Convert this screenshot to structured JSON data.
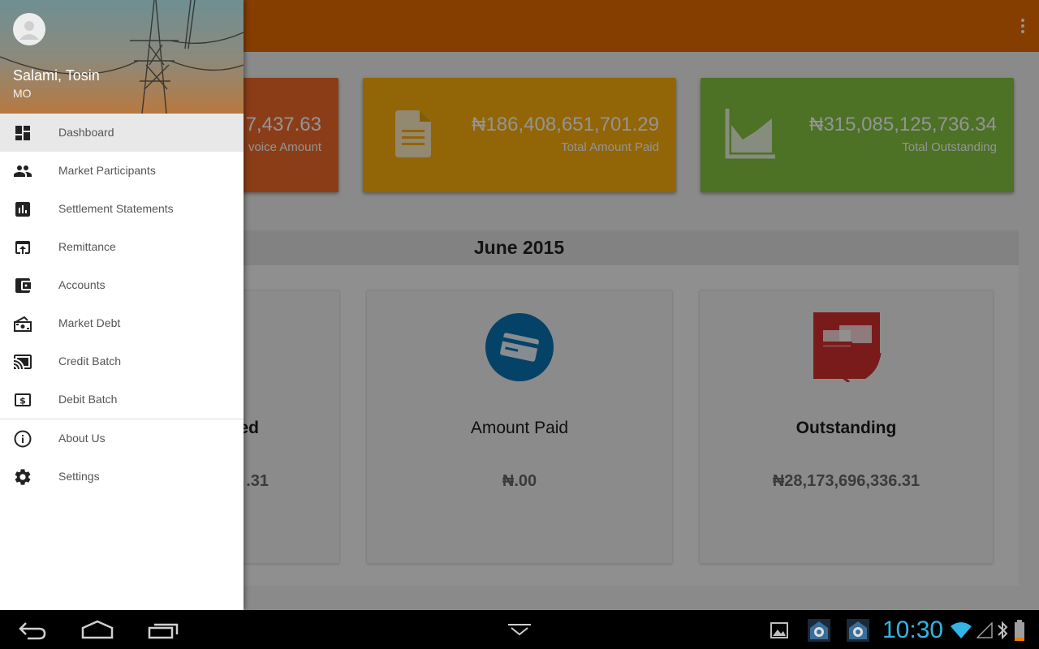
{
  "app": {
    "toolbar_color": "#e56a00",
    "overflow_icon": "more-vert-icon"
  },
  "stats": [
    {
      "amount": "7,437.63",
      "caption": "voice Amount",
      "color": "#f06a2a",
      "icon": "invoice-icon"
    },
    {
      "amount": "₦186,408,651,701.29",
      "caption": "Total Amount Paid",
      "color": "#fbae0b",
      "icon": "document-icon"
    },
    {
      "amount": "₦315,085,125,736.34",
      "caption": "Total Outstanding",
      "color": "#86c341",
      "icon": "area-chart-icon"
    }
  ],
  "month": {
    "title": "June 2015",
    "cards": [
      {
        "title": "ed",
        "value": ".31"
      },
      {
        "title": "Amount Paid",
        "value": "₦.00",
        "icon": "credit-card-icon",
        "icon_color": "#0a73b2"
      },
      {
        "title": "Outstanding",
        "value": "₦28,173,696,336.31",
        "icon": "outstanding-bills-icon",
        "icon_color": "#d32f2f"
      }
    ]
  },
  "drawer": {
    "user_name": "Salami, Tosin",
    "user_role": "MO",
    "items": [
      {
        "label": "Dashboard",
        "icon": "dashboard-icon",
        "active": true
      },
      {
        "label": "Market Participants",
        "icon": "people-icon"
      },
      {
        "label": "Settlement Statements",
        "icon": "bar-chart-icon"
      },
      {
        "label": "Remittance",
        "icon": "upload-icon"
      },
      {
        "label": "Accounts",
        "icon": "wallet-icon"
      },
      {
        "label": "Market Debt",
        "icon": "cash-icon"
      },
      {
        "label": "Credit Batch",
        "icon": "cast-icon"
      },
      {
        "label": "Debit Batch",
        "icon": "dollar-box-icon"
      },
      {
        "label": "About Us",
        "icon": "info-icon"
      },
      {
        "label": "Settings",
        "icon": "gear-icon"
      }
    ]
  },
  "system_bar": {
    "time": "10:30",
    "clock_color": "#33b5e5"
  }
}
